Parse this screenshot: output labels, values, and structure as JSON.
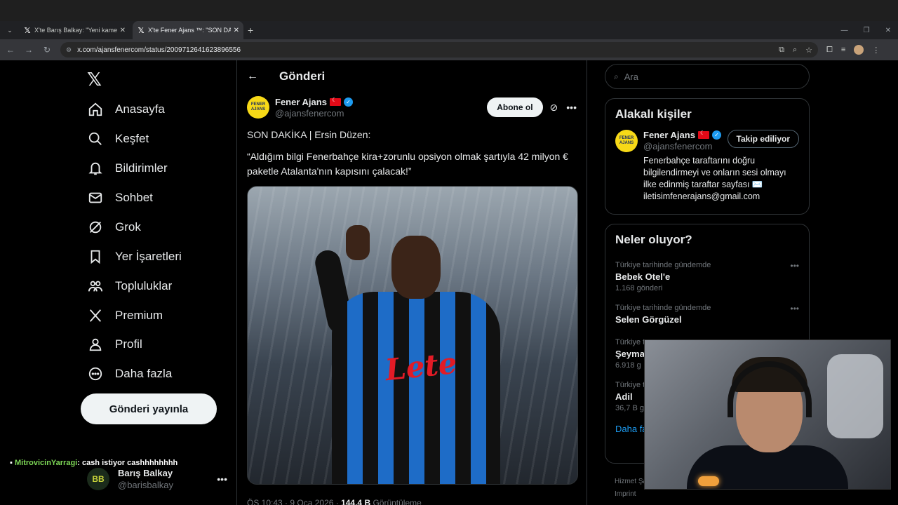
{
  "browser": {
    "tabs": [
      {
        "title": "X'te Barış Balkay: \"Yeni kamera",
        "active": false
      },
      {
        "title": "X'te Fener Ajans ™: \"SON DAKİ",
        "active": true
      }
    ],
    "url": "x.com/ajansfenercom/status/2009712641623896556"
  },
  "nav": {
    "items": [
      {
        "label": "Anasayfa",
        "icon": "home-icon"
      },
      {
        "label": "Keşfet",
        "icon": "search-icon"
      },
      {
        "label": "Bildirimler",
        "icon": "bell-icon"
      },
      {
        "label": "Sohbet",
        "icon": "mail-icon"
      },
      {
        "label": "Grok",
        "icon": "grok-icon"
      },
      {
        "label": "Yer İşaretleri",
        "icon": "bookmark-icon"
      },
      {
        "label": "Topluluklar",
        "icon": "communities-icon"
      },
      {
        "label": "Premium",
        "icon": "x-premium-icon"
      },
      {
        "label": "Profil",
        "icon": "person-icon"
      },
      {
        "label": "Daha fazla",
        "icon": "more-circle-icon"
      }
    ],
    "post_button": "Gönderi yayınla",
    "account": {
      "name": "Barış Balkay",
      "handle": "@barisbalkay",
      "avatar_text": "BB"
    }
  },
  "chat_overlay": {
    "user": "MitrovicinYarragi",
    "message": ": cash istiyor cashhhhhhhh"
  },
  "header": {
    "title": "Gönderi"
  },
  "tweet": {
    "author_name": "Fener Ajans",
    "author_handle": "@ajansfenercom",
    "logo_text": "FENER AJANS",
    "subscribe": "Abone ol",
    "text_line1": "SON DAKİKA | Ersin Düzen:",
    "text_line2": "“Aldığım bilgi Fenerbahçe kira+zorunlu opsiyon olmak şartıyla 42 milyon € paketle Atalanta'nın kapısını çalacak!”",
    "sponsor": "Lete",
    "meta_time": "ÖS 10:43 · 9 Oca 2026 · ",
    "meta_views": "144,4 B",
    "meta_views_label": " Görüntüleme"
  },
  "search": {
    "placeholder": "Ara"
  },
  "related": {
    "title": "Alakalı kişiler",
    "name": "Fener Ajans",
    "handle": "@ajansfenercom",
    "follow": "Takip ediliyor",
    "bio": "Fenerbahçe taraftarını doğru bilgilendirmeyi ve onların sesi olmayı ilke edinmiş taraftar sayfası ✉️ iletisimfenerajans@gmail.com"
  },
  "trends": {
    "title": "Neler oluyor?",
    "items": [
      {
        "context": "Türkiye tarihinde gündemde",
        "name": "Bebek Otel'e",
        "count": "1.168 gönderi"
      },
      {
        "context": "Türkiye tarihinde gündemde",
        "name": "Selen Görgüzel",
        "count": ""
      },
      {
        "context": "Türkiye t",
        "name": "Şeyma",
        "count": "6.918 g"
      },
      {
        "context": "Türkiye t",
        "name": "Adil",
        "count": "36,7 B g"
      }
    ],
    "show_more": "Daha fa"
  },
  "footer": {
    "line1": "Hizmet Şa",
    "line2": "Imprint"
  },
  "colors": {
    "accent": "#1d9bf0",
    "background": "#000000",
    "border": "#2f3336"
  }
}
